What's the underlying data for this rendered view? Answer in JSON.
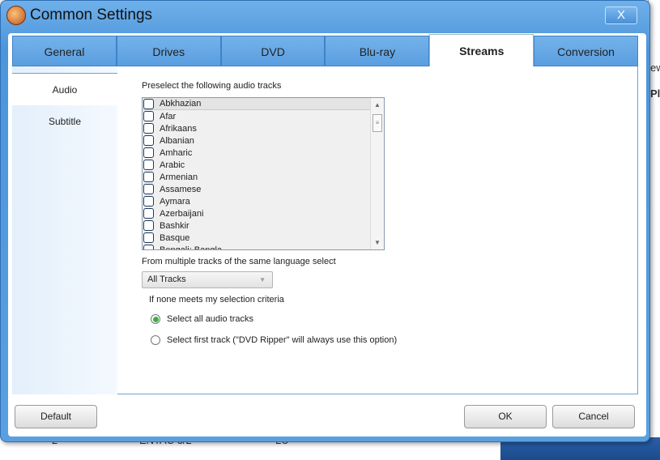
{
  "background": {
    "right_texts": [
      "ew",
      "Pl"
    ],
    "bottom_texts": [
      "2",
      "ENTAC 3/2",
      "LU"
    ]
  },
  "dialog": {
    "title": "Common Settings",
    "close_label": "X"
  },
  "tabs": [
    "General",
    "Drives",
    "DVD",
    "Blu-ray",
    "Streams",
    "Conversion"
  ],
  "active_tab": "Streams",
  "sidebar": [
    "Audio",
    "Subtitle"
  ],
  "audio": {
    "preselect_label": "Preselect the following audio tracks",
    "languages": [
      "Abkhazian",
      "Afar",
      "Afrikaans",
      "Albanian",
      "Amharic",
      "Arabic",
      "Armenian",
      "Assamese",
      "Aymara",
      "Azerbaijani",
      "Bashkir",
      "Basque",
      "Bengali; Bangla"
    ],
    "multiple_label": "From multiple tracks of the same language select",
    "multiple_value": "All Tracks",
    "none_label": "If none meets my selection criteria",
    "options": [
      "Select all audio tracks",
      "Select first track (\"DVD Ripper\" will always use this option)"
    ],
    "selected_option": 0
  },
  "buttons": {
    "default": "Default",
    "ok": "OK",
    "cancel": "Cancel"
  }
}
